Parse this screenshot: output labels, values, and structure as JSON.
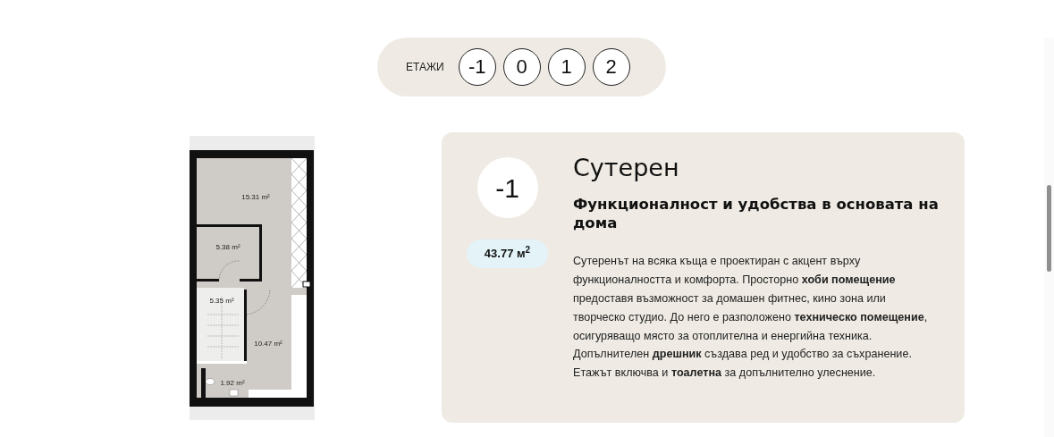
{
  "floor_selector": {
    "label": "ЕТАЖИ",
    "floors": [
      "-1",
      "0",
      "1",
      "2"
    ]
  },
  "plan": {
    "rooms": [
      {
        "area": "15.31 m²"
      },
      {
        "area": "5.38 m²"
      },
      {
        "area": "5.35 m²"
      },
      {
        "area": "10.47 m²"
      },
      {
        "area": "1.92 m²"
      }
    ]
  },
  "floor_card": {
    "number": "-1",
    "area": "43.77 м$^{2}$",
    "title": "Сутерен",
    "subtitle": "Функционалност и удобства в основата на дома",
    "description": "Сутеренът на всяка къща е проектиран с акцент върху функционалността и комфорта. Просторно **хоби помещение** предоставя възможност за домашен фитнес, кино зона или творческо студио. До него е разположено **техническо помещение**, осигуряващо място за отоплителна и енергийна техника. Допълнителен **дрешник** създава ред и удобство за съхранение. Етажът включва и **тоалетна** за допълнително улеснение."
  }
}
